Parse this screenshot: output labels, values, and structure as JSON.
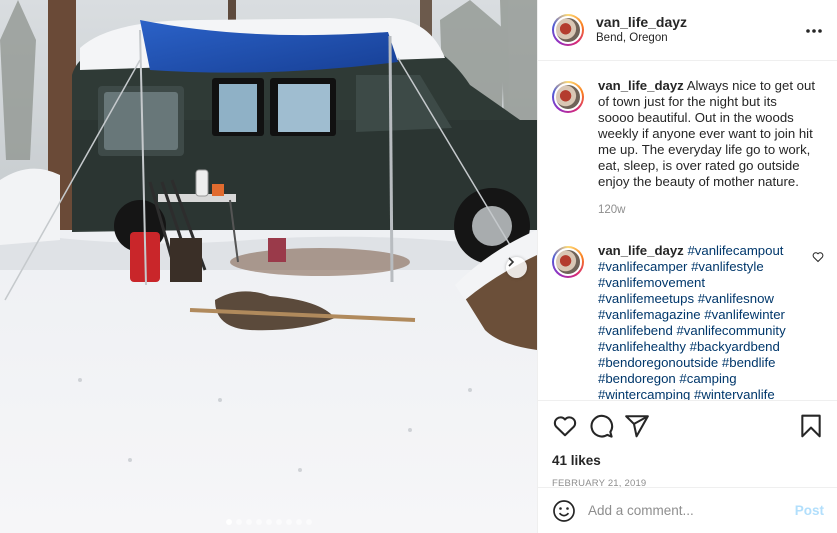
{
  "post": {
    "username": "van_life_dayz",
    "location": "Bend, Oregon",
    "more_icon": "more-dots-icon"
  },
  "photo": {
    "carousel_total": 9,
    "carousel_active_index": 1,
    "next_icon": "chevron-right-icon"
  },
  "caption": {
    "username": "van_life_dayz",
    "text": "Always nice to get out of town just for the night but its soooo beautiful. Out in the woods weekly if anyone ever want to join hit me up. The everyday life go to work, eat, sleep, is over rated go outside enjoy the beauty of mother nature.",
    "time_ago": "120w"
  },
  "comment": {
    "username": "van_life_dayz",
    "hashtags": "#vanlifecampout #vanlifecamper #vanlifestyle #vanlifemovement #vanlifemeetups #vanlifesnow #vanlifemagazine #vanlifewinter #vanlifebend #vanlifecommunity #vanlifehealthy #backyardbend #bendoregonoutside #bendlife #bendoregon #camping #wintercamping #wintervanlife"
  },
  "actions": {
    "icons": [
      "heart-icon",
      "comment-icon",
      "share-icon",
      "bookmark-icon"
    ],
    "likes": "41 likes",
    "date": "FEBRUARY 21, 2019"
  },
  "add_comment": {
    "placeholder": "Add a comment...",
    "post_label": "Post",
    "emoji_icon": "emoji-icon"
  },
  "colors": {
    "link": "#00376b",
    "muted": "#8e8e8e",
    "post_button": "#b2dffc",
    "tarp": "#1f4fb3",
    "van": "#2f3a36"
  }
}
